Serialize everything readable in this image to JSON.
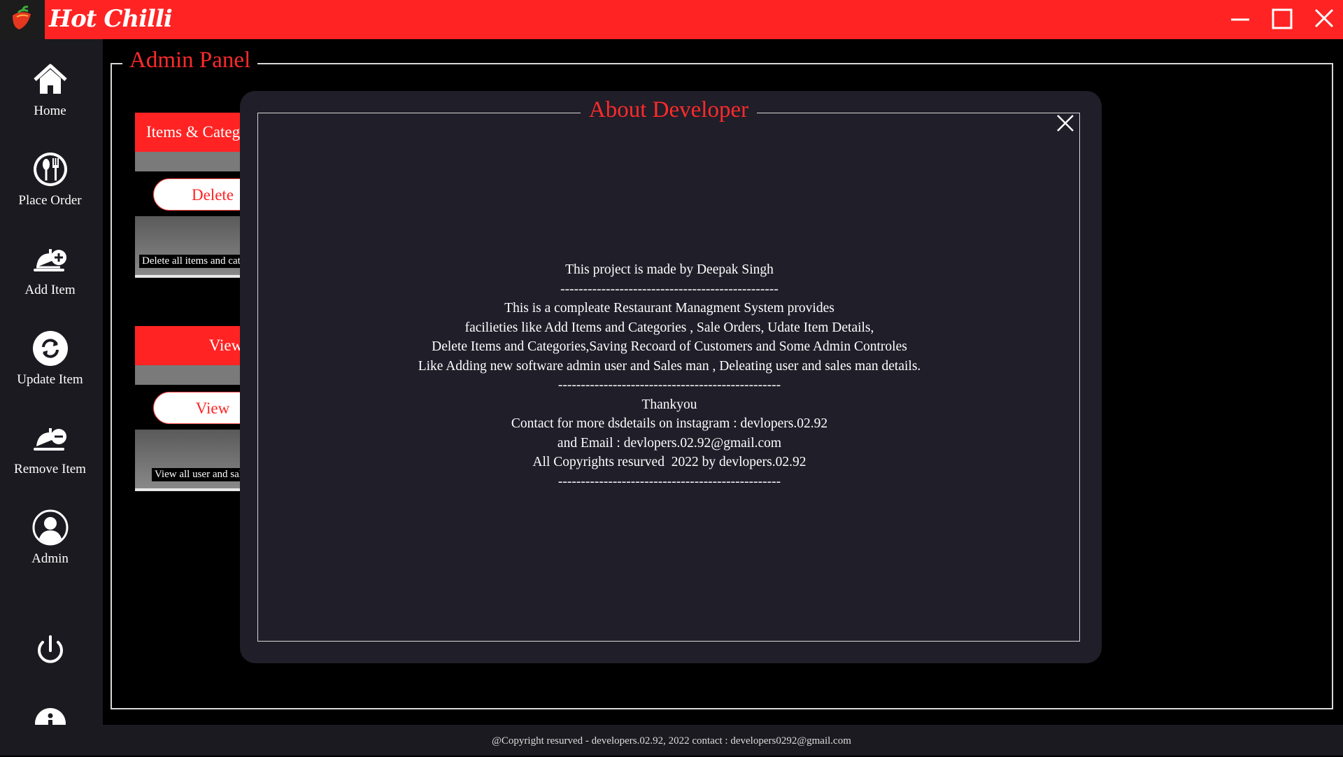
{
  "titlebar": {
    "app_title": "Hot Chilli",
    "logo_icon": "chilli-logo-icon",
    "controls": [
      "minimize-icon",
      "maximize-icon",
      "close-icon"
    ]
  },
  "sidebar": {
    "items": [
      {
        "label": "Home",
        "icon": "home-icon"
      },
      {
        "label": "Place Order",
        "icon": "fork-spoon-icon"
      },
      {
        "label": "Add Item",
        "icon": "cloche-plus-icon"
      },
      {
        "label": "Update Item",
        "icon": "refresh-icon"
      },
      {
        "label": "Remove Item",
        "icon": "cloche-minus-icon"
      },
      {
        "label": "Admin",
        "icon": "user-icon"
      }
    ],
    "power_icon": "power-icon",
    "info_icon": "info-icon"
  },
  "main": {
    "panel_title": "Admin Panel",
    "cards": [
      {
        "header": "Items & Categories",
        "button": "Delete",
        "caption": "Delete all items and categories"
      },
      {
        "header": "View",
        "button": "View",
        "caption": "View all user and sales man"
      }
    ]
  },
  "modal": {
    "title": "About Developer",
    "close_icon": "close-icon",
    "lines": [
      "This project is made by Deepak Singh",
      "------------------------------------------------",
      "This is a compleate Restaurant Managment System provides",
      "facilieties like Add Items and Categories , Sale Orders, Udate Item Details,",
      "Delete Items and Categories,Saving Recoard of Customers and Some Admin Controles",
      "Like Adding new software admin user and Sales man , Deleating user and sales man details.",
      "-------------------------------------------------",
      "Thankyou",
      "Contact for more dsdetails on instagram : devlopers.02.92",
      "and Email : devlopers.02.92@gmail.com",
      "All Copyrights resurved  2022 by devlopers.02.92",
      "-------------------------------------------------"
    ]
  },
  "footer": {
    "text": "@Copyright resurved - developers.02.92, 2022  contact : developers0292@gmail.com"
  },
  "colors": {
    "accent": "#ff2323",
    "sidebar_bg": "#1b1a20",
    "modal_bg": "#1f1e29"
  }
}
